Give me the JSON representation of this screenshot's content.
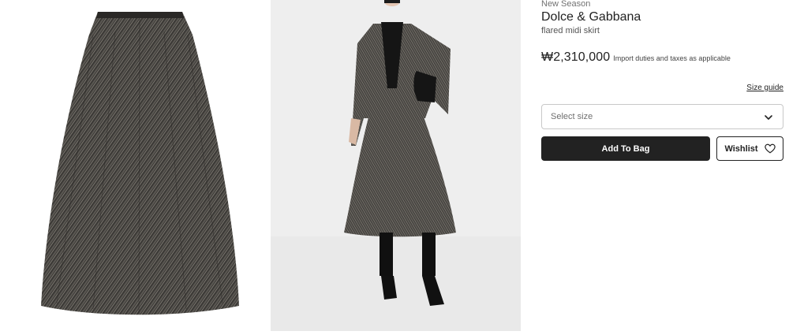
{
  "product": {
    "season_tag": "New Season",
    "brand": "Dolce & Gabbana",
    "description": "flared midi skirt",
    "price": "₩2,310,000",
    "tax_note": "Import duties and taxes as applicable",
    "size_guide_label": "Size guide",
    "size_select": {
      "placeholder": "Select size",
      "icon": "chevron-down-icon"
    },
    "add_to_bag_label": "Add To Bag",
    "wishlist": {
      "label": "Wishlist",
      "icon": "heart-icon"
    }
  },
  "colors": {
    "primary_button": "#222222",
    "text": "#222222",
    "muted_text": "#727272",
    "border": "#c8c8c8",
    "image_background": "#eeeeee"
  }
}
